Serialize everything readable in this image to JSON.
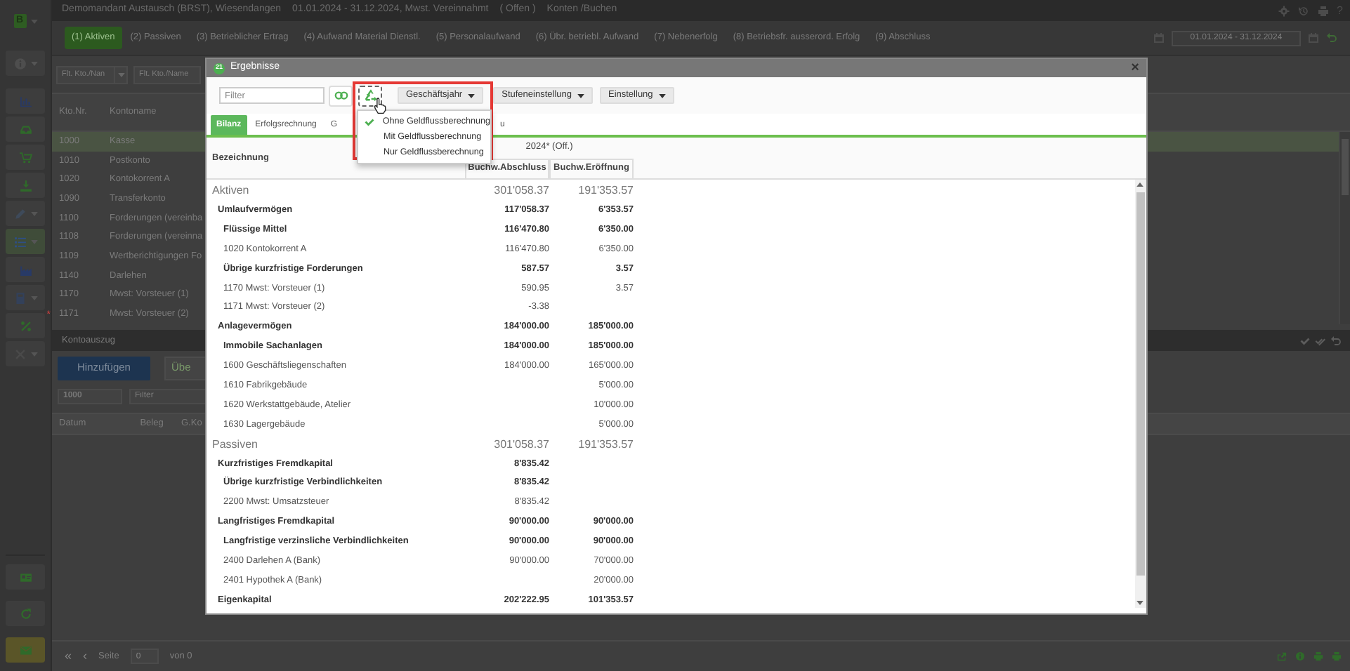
{
  "app": {
    "badge": "B",
    "title": "Demomandant Austausch (BRST), Wiesendangen",
    "period": "01.01.2024 - 31.12.2024, Mwst. Vereinnahmt",
    "status": "( Offen )",
    "section": "Konten /Buchen",
    "help": "?",
    "tabs": [
      {
        "label": "(1) Aktiven",
        "selected": true
      },
      {
        "label": "(2) Passiven",
        "selected": false
      },
      {
        "label": "(3) Betrieblicher Ertrag",
        "selected": false
      },
      {
        "label": "(4) Aufwand Material Dienstl.",
        "selected": false
      },
      {
        "label": "(5) Personalaufwand",
        "selected": false
      },
      {
        "label": "(6) Übr. betriebl. Aufwand",
        "selected": false
      },
      {
        "label": "(7) Nebenerfolg",
        "selected": false
      },
      {
        "label": "(8) Betriebsfr. ausserord. Erfolg",
        "selected": false
      },
      {
        "label": "(9) Abschluss",
        "selected": false
      }
    ],
    "date_range": "01.01.2024 - 31.12.2024"
  },
  "sidebar": {
    "items": [
      {
        "has_menu": true,
        "selected": false
      },
      {
        "has_menu": false,
        "selected": false
      },
      {
        "has_menu": false,
        "selected": false
      },
      {
        "has_menu": false,
        "selected": false
      },
      {
        "has_menu": false,
        "selected": false
      },
      {
        "has_menu": true,
        "selected": false
      },
      {
        "has_menu": true,
        "selected": true
      },
      {
        "has_menu": false,
        "selected": false
      },
      {
        "has_menu": true,
        "selected": false
      },
      {
        "has_menu": false,
        "selected": false,
        "flag": "*"
      },
      {
        "has_menu": true,
        "selected": false
      }
    ],
    "footer_items": [
      {
        "highlighted": false
      },
      {
        "highlighted": false
      },
      {
        "highlighted": true
      }
    ]
  },
  "accounts": {
    "filter_placeholders": [
      "Flt. Kto./Nan",
      "Flt. Kto./Name"
    ],
    "columns": [
      "Kto.Nr.",
      "Kontoname"
    ],
    "rows": [
      {
        "number": "1000",
        "name": "Kasse",
        "selected": true
      },
      {
        "number": "1010",
        "name": "Postkonto",
        "selected": false
      },
      {
        "number": "1020",
        "name": "Kontokorrent A",
        "selected": false
      },
      {
        "number": "1090",
        "name": "Transferkonto",
        "selected": false
      },
      {
        "number": "1100",
        "name": "Forderungen (vereinba",
        "selected": false
      },
      {
        "number": "1108",
        "name": "Forderungen (vereinna",
        "selected": false
      },
      {
        "number": "1109",
        "name": "Wertberichtigungen Fo",
        "selected": false
      },
      {
        "number": "1140",
        "name": "Darlehen",
        "selected": false
      },
      {
        "number": "1170",
        "name": "Mwst: Vorsteuer (1)",
        "selected": false
      },
      {
        "number": "1171",
        "name": "Mwst: Vorsteuer (2)",
        "selected": false
      }
    ]
  },
  "statement": {
    "title": "Kontoauszug",
    "buttons": [
      "Hinzufügen",
      "Übe"
    ],
    "account": "1000",
    "filter_placeholder": "Filter",
    "columns": [
      "Datum",
      "Beleg",
      "G.Ko"
    ],
    "pager": {
      "first": "«",
      "prev": "‹",
      "page_label": "Seite",
      "page": "0",
      "total": "von 0"
    }
  },
  "dialog": {
    "icon_text": "21",
    "title": "Ergebnisse",
    "close": "×",
    "filter_placeholder": "Filter",
    "menus": [
      "Geschäftsjahr",
      "Stufeneinstellung",
      "Einstellung"
    ],
    "dropdown": [
      {
        "label": "Ohne Geldflussberechnung",
        "checked": true
      },
      {
        "label": "Mit Geldflussberechnung",
        "checked": false
      },
      {
        "label": "Nur Geldflussberechnung",
        "checked": false
      }
    ],
    "tabs": [
      {
        "label": "Bilanz",
        "selected": true
      },
      {
        "label": "Erfolgsrechnung",
        "selected": false
      },
      {
        "label": "G",
        "selected": false
      },
      {
        "label": "u",
        "selected": false
      }
    ],
    "table": {
      "label_column": "Bezeichnung",
      "group_header": "2024* (Off.)",
      "columns": [
        "Buchw.Abschluss",
        "Buchw.Eröffnung"
      ],
      "rows": [
        {
          "label": "Aktiven",
          "closing": "301'058.37",
          "opening": "191'353.57",
          "children": [
            {
              "label": "Umlaufvermögen",
              "closing": "117'058.37",
              "opening": "6'353.57",
              "children": [
                {
                  "label": "Flüssige Mittel",
                  "closing": "116'470.80",
                  "opening": "6'350.00",
                  "children": [
                    {
                      "label": "1020 Kontokorrent A",
                      "closing": "116'470.80",
                      "opening": "6'350.00"
                    }
                  ]
                },
                {
                  "label": "Übrige kurzfristige Forderungen",
                  "closing": "587.57",
                  "opening": "3.57",
                  "children": [
                    {
                      "label": "1170 Mwst: Vorsteuer (1)",
                      "closing": "590.95",
                      "opening": "3.57"
                    },
                    {
                      "label": "1171 Mwst: Vorsteuer (2)",
                      "closing": "-3.38"
                    }
                  ]
                }
              ]
            },
            {
              "label": "Anlagevermögen",
              "closing": "184'000.00",
              "opening": "185'000.00",
              "children": [
                {
                  "label": "Immobile Sachanlagen",
                  "closing": "184'000.00",
                  "opening": "185'000.00",
                  "children": [
                    {
                      "label": "1600 Geschäftsliegenschaften",
                      "closing": "184'000.00",
                      "opening": "165'000.00"
                    },
                    {
                      "label": "1610 Fabrikgebäude",
                      "opening": "5'000.00"
                    },
                    {
                      "label": "1620 Werkstattgebäude, Atelier",
                      "opening": "10'000.00"
                    },
                    {
                      "label": "1630 Lagergebäude",
                      "opening": "5'000.00"
                    }
                  ]
                }
              ]
            }
          ]
        },
        {
          "label": "Passiven",
          "closing": "301'058.37",
          "opening": "191'353.57",
          "children": [
            {
              "label": "Kurzfristiges Fremdkapital",
              "closing": "8'835.42",
              "children": [
                {
                  "label": "Übrige kurzfristige Verbindlichkeiten",
                  "closing": "8'835.42",
                  "children": [
                    {
                      "label": "2200 Mwst: Umsatzsteuer",
                      "closing": "8'835.42"
                    }
                  ]
                }
              ]
            },
            {
              "label": "Langfristiges Fremdkapital",
              "closing": "90'000.00",
              "opening": "90'000.00",
              "children": [
                {
                  "label": "Langfristige verzinsliche Verbindlichkeiten",
                  "closing": "90'000.00",
                  "opening": "90'000.00",
                  "children": [
                    {
                      "label": "2400 Darlehen A (Bank)",
                      "closing": "90'000.00",
                      "opening": "70'000.00"
                    },
                    {
                      "label": "2401 Hypothek A (Bank)",
                      "opening": "20'000.00"
                    }
                  ]
                }
              ]
            },
            {
              "label": "Eigenkapital",
              "closing": "202'222.95",
              "opening": "101'353.57",
              "is_group": true
            }
          ]
        }
      ]
    }
  }
}
